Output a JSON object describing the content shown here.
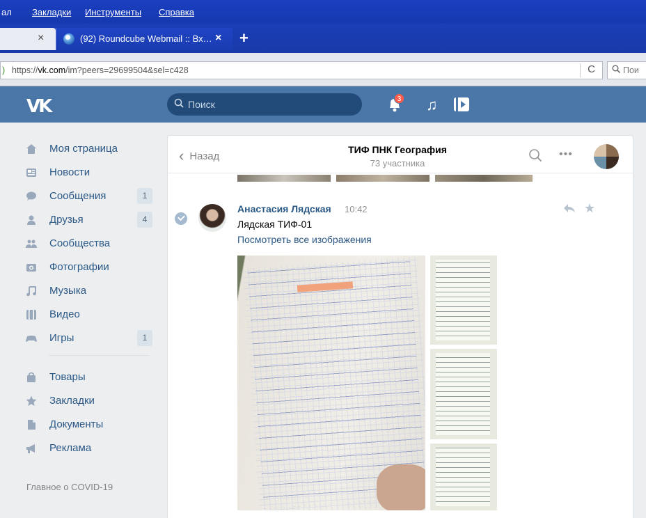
{
  "browser": {
    "menu": [
      {
        "label": "ал",
        "underline": false
      },
      {
        "label": "Закладки",
        "underline": true
      },
      {
        "label": "Инструменты",
        "underline": true
      },
      {
        "label": "Справка",
        "underline": true
      }
    ],
    "tabs": {
      "inactive_close": "×",
      "active_title": "(92) Roundcube Webmail :: Вх…",
      "active_close": "×",
      "new_tab": "+"
    },
    "url": {
      "prefix": "https://",
      "domain": "vk.com",
      "path": "/im?peers=29699504&sel=c428",
      "lock": ")"
    },
    "reload": "C",
    "search_placeholder": "Пои"
  },
  "vk": {
    "logo": "VK",
    "search_placeholder": "Поиск",
    "notifications_count": "3",
    "accent": "#4a76a8"
  },
  "sidebar": {
    "items": [
      {
        "label": "Моя страница",
        "icon": "home-icon",
        "count": ""
      },
      {
        "label": "Новости",
        "icon": "news-icon",
        "count": ""
      },
      {
        "label": "Сообщения",
        "icon": "messages-icon",
        "count": "1"
      },
      {
        "label": "Друзья",
        "icon": "friends-icon",
        "count": "4"
      },
      {
        "label": "Сообщества",
        "icon": "groups-icon",
        "count": ""
      },
      {
        "label": "Фотографии",
        "icon": "camera-icon",
        "count": ""
      },
      {
        "label": "Музыка",
        "icon": "music-icon",
        "count": ""
      },
      {
        "label": "Видео",
        "icon": "video-icon",
        "count": ""
      },
      {
        "label": "Игры",
        "icon": "gamepad-icon",
        "count": "1"
      },
      {
        "label": "Товары",
        "icon": "bag-icon",
        "count": ""
      },
      {
        "label": "Закладки",
        "icon": "star-icon",
        "count": ""
      },
      {
        "label": "Документы",
        "icon": "document-icon",
        "count": ""
      },
      {
        "label": "Реклама",
        "icon": "megaphone-icon",
        "count": ""
      }
    ],
    "footer": "Главное о COVID-19"
  },
  "chat": {
    "back": "Назад",
    "title": "ТИФ ПНК География",
    "subtitle": "73 участника",
    "more": "•••"
  },
  "message": {
    "author": "Анастасия Лядская",
    "time": "10:42",
    "text": "Лядская ТИФ-01",
    "link": "Посмотреть все изображения"
  }
}
